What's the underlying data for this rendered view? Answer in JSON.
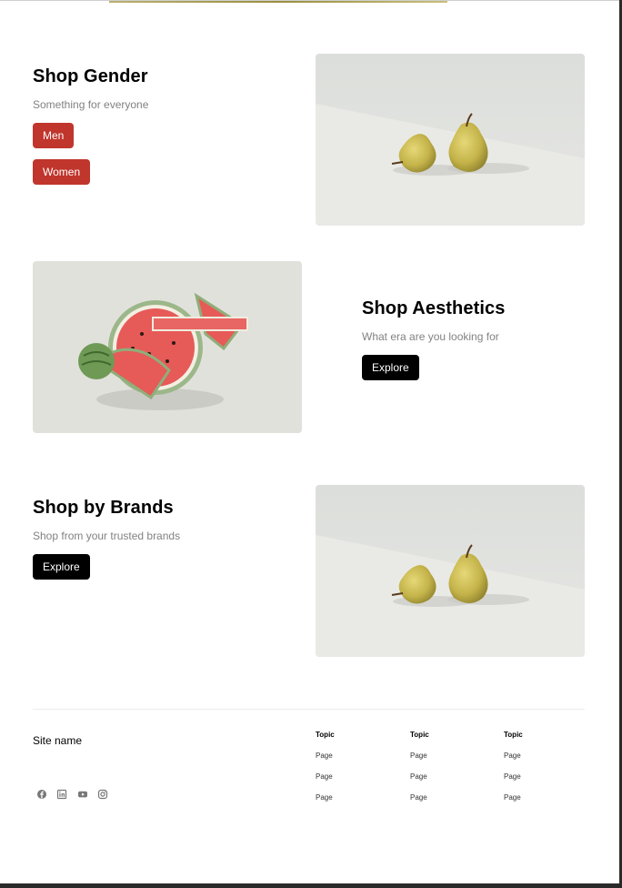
{
  "gender": {
    "title": "Shop Gender",
    "subtitle": "Something for everyone",
    "buttons": [
      "Men",
      "Women"
    ]
  },
  "aesthetics": {
    "title": "Shop Aesthetics",
    "subtitle": "What era are you looking for",
    "button": "Explore"
  },
  "brands": {
    "title": "Shop by Brands",
    "subtitle": "Shop from your trusted brands",
    "button": "Explore"
  },
  "footer": {
    "site_name": "Site name",
    "social_icons": [
      "facebook-icon",
      "linkedin-icon",
      "youtube-icon",
      "instagram-icon"
    ],
    "columns": [
      {
        "topic": "Topic",
        "pages": [
          "Page",
          "Page",
          "Page"
        ]
      },
      {
        "topic": "Topic",
        "pages": [
          "Page",
          "Page",
          "Page"
        ]
      },
      {
        "topic": "Topic",
        "pages": [
          "Page",
          "Page",
          "Page"
        ]
      }
    ]
  },
  "colors": {
    "accent_red": "#c0352c",
    "button_black": "#000000",
    "subtitle_gray": "#828282"
  }
}
